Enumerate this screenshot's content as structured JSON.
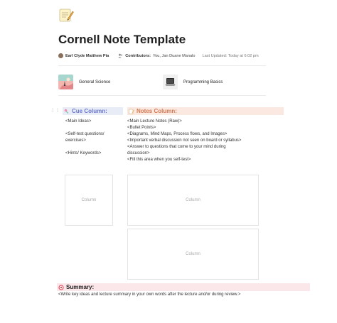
{
  "page": {
    "icon": "memo-icon",
    "title": "Cornell Note Template",
    "author": "Earl Clyde Matthew Pia",
    "contributors_label": "Contributors:",
    "contributors": "You, Jan Duane Manalo",
    "last_updated": "Last Updated: Today at 6:02 pm"
  },
  "linked_docs": [
    {
      "label": "General Science",
      "icon": "landscape-thumbnail"
    },
    {
      "label": "Programming Basics",
      "icon": "laptop-thumbnail"
    }
  ],
  "cue_column": {
    "title": "Cue Column:",
    "lines": [
      "<Main Ideas>",
      "",
      "<Self-test questions/",
      "exercises>",
      "",
      "<Hints/ Keywords>"
    ]
  },
  "notes_column": {
    "title": "Notes Column:",
    "lines": [
      "<Main Lecture Notes (Raw)>",
      "<Bullet Points>",
      "<Diagrams, Mind Maps, Process flows, and Images>",
      "<Important verbal discussion not seen on board or syllabus>",
      "<Answer to questions that come to your mind during",
      "discussion>",
      "<Fill this area when you self-test>"
    ]
  },
  "column_placeholder": "Column",
  "summary": {
    "title": "Summary:",
    "text": "<Write key ideas and lecture summary in your own words after the lecture and/or during review.>"
  },
  "colors": {
    "cue_accent": "#6b78c9",
    "notes_accent": "#d17a55",
    "summary_bg": "#fbe6ea"
  }
}
